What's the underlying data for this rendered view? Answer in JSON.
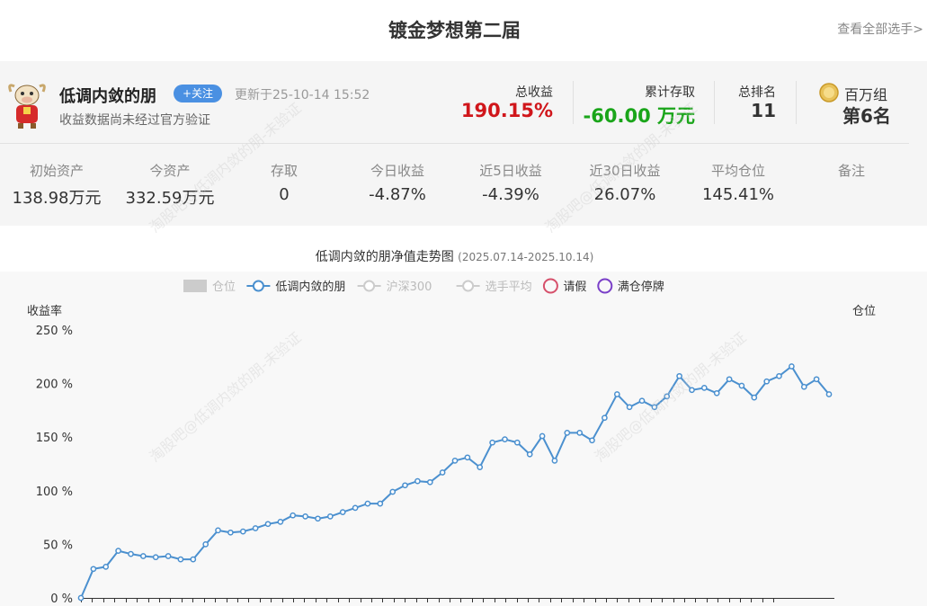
{
  "header": {
    "title": "镀金梦想第二届",
    "view_all": "查看全部选手>"
  },
  "profile": {
    "name": "低调内敛的朋",
    "follow_label": "+关注",
    "updated": "更新于25-10-14 15:52",
    "notice": "收益数据尚未经过官方验证"
  },
  "summary": {
    "total_return_label": "总收益",
    "total_return": "190.15%",
    "cum_deposit_label": "累计存取",
    "cum_deposit": "-60.00 万元",
    "rank_label": "总排名",
    "rank": "11",
    "group_label": "百万组",
    "group_rank": "第6名"
  },
  "metrics": [
    {
      "label": "初始资产",
      "value": "138.98万元",
      "color": "#333333"
    },
    {
      "label": "今资产",
      "value": "332.59万元",
      "color": "#333333"
    },
    {
      "label": "存取",
      "value": "0",
      "color": "#333333"
    },
    {
      "label": "今日收益",
      "value": "-4.87%",
      "color": "#1aa51a"
    },
    {
      "label": "近5日收益",
      "value": "-4.39%",
      "color": "#1aa51a"
    },
    {
      "label": "近30日收益",
      "value": "26.07%",
      "color": "#d0161b"
    },
    {
      "label": "平均仓位",
      "value": "145.41%",
      "color": "#d0161b"
    },
    {
      "label": "备注",
      "value": "",
      "color": "#333333"
    }
  ],
  "watermark": "淘股吧@低调内敛的朋-未验证",
  "chart": {
    "title": "低调内敛的朋净值走势图",
    "range": "(2025.07.14-2025.10.14)",
    "legend": [
      {
        "name": "仓位",
        "type": "rect",
        "color": "#cccccc",
        "active": false
      },
      {
        "name": "低调内敛的朋",
        "type": "line",
        "color": "#4b90cf",
        "active": true
      },
      {
        "name": "沪深300",
        "type": "line",
        "color": "#cccccc",
        "active": false
      },
      {
        "name": "选手平均",
        "type": "line",
        "color": "#cccccc",
        "active": false
      },
      {
        "name": "请假",
        "type": "circle",
        "color": "#d6506b",
        "active": true
      },
      {
        "name": "满仓停牌",
        "type": "circle",
        "color": "#7a3fc8",
        "active": true
      }
    ],
    "y_left_label": "收益率",
    "y_right_label": "仓位",
    "accent": "#4b90cf"
  },
  "chart_data": {
    "type": "line",
    "ylabel": "收益率",
    "y2label": "仓位",
    "y_ticks": [
      "0 %",
      "50 %",
      "100 %",
      "150 %",
      "200 %",
      "250 %"
    ],
    "ylim": [
      0,
      250
    ],
    "series": [
      {
        "name": "低调内敛的朋",
        "values": [
          0,
          27,
          29,
          44,
          41,
          39,
          38,
          39,
          36,
          36,
          50,
          63,
          61,
          62,
          65,
          69,
          71,
          77,
          76,
          74,
          76,
          80,
          84,
          88,
          88,
          99,
          105,
          109,
          108,
          117,
          128,
          131,
          122,
          145,
          148,
          145,
          134,
          151,
          128,
          154,
          154,
          147,
          168,
          190,
          178,
          184,
          178,
          188,
          207,
          194,
          196,
          191,
          204,
          198,
          187,
          202,
          207,
          216,
          197,
          204,
          190
        ]
      }
    ]
  }
}
